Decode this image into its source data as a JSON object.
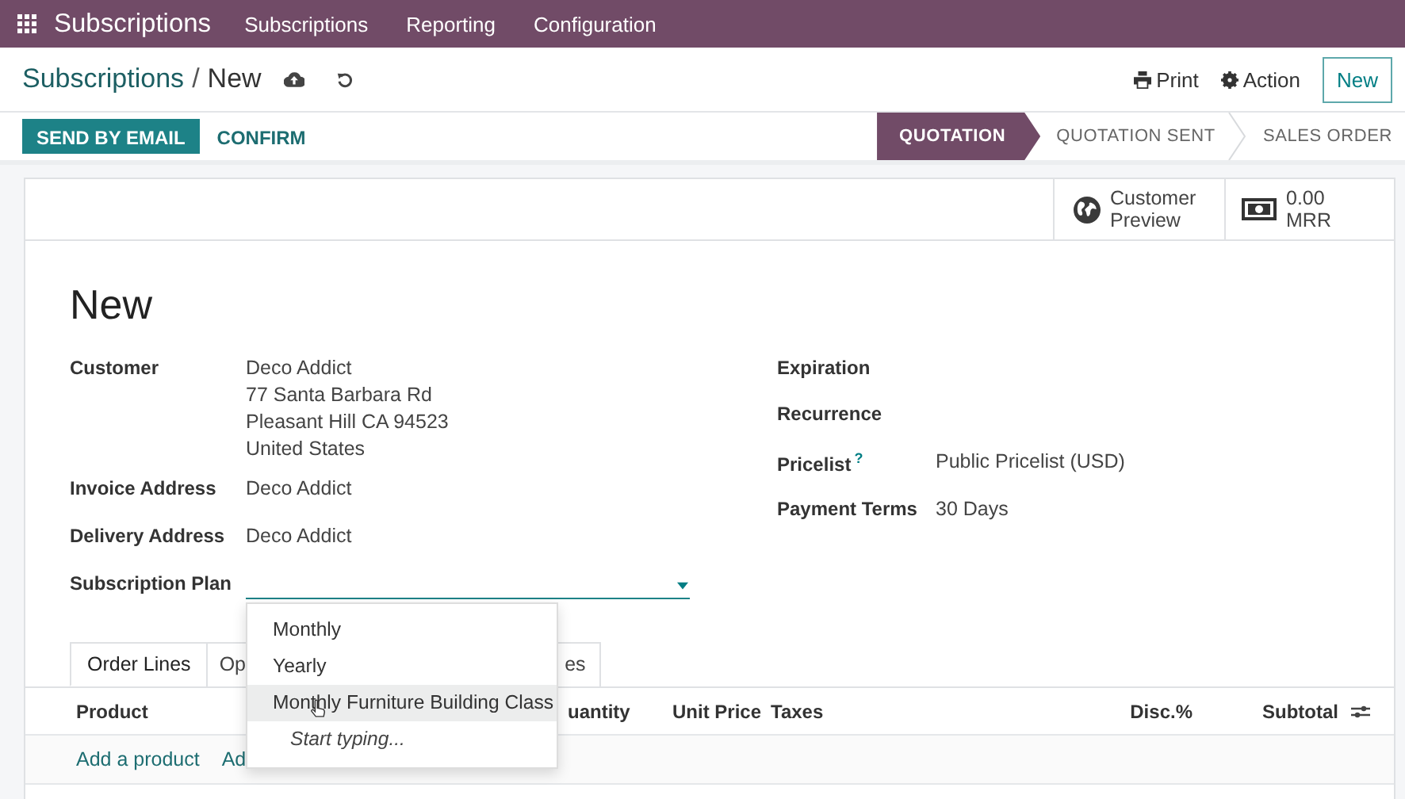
{
  "topbar": {
    "app": "Subscriptions",
    "menu": [
      "Subscriptions",
      "Reporting",
      "Configuration"
    ]
  },
  "breadcrumb": {
    "parent": "Subscriptions",
    "separator": "/",
    "current": "New"
  },
  "actions": [
    {
      "label": "Print",
      "kind": "print"
    },
    {
      "label": "Action",
      "kind": "gear"
    }
  ],
  "new_button": "New",
  "buttons": [
    {
      "label": "SEND BY EMAIL",
      "primary": true
    },
    {
      "label": "CONFIRM",
      "primary": false
    }
  ],
  "stages": [
    {
      "label": "QUOTATION",
      "selected": true
    },
    {
      "label": "QUOTATION SENT",
      "selected": false
    },
    {
      "label": "SALES ORDER",
      "selected": false
    }
  ],
  "smart_buttons": [
    {
      "kind": "globe",
      "lines": [
        "Customer",
        "Preview"
      ]
    },
    {
      "kind": "money",
      "lines": [
        "0.00",
        "MRR"
      ]
    }
  ],
  "title": "New",
  "left_fields": [
    {
      "label": "Customer",
      "lines": [
        "Deco Addict",
        "77 Santa Barbara Rd",
        "Pleasant Hill CA 94523",
        "United States"
      ]
    },
    {
      "label": "Invoice Address",
      "lines": [
        "Deco Addict"
      ]
    },
    {
      "label": "Delivery Address",
      "lines": [
        "Deco Addict"
      ]
    }
  ],
  "subscription_plan": {
    "label": "Subscription Plan"
  },
  "right_fields": [
    {
      "label": "Expiration"
    },
    {
      "label": "Recurrence"
    },
    {
      "label": "Pricelist",
      "help": "?",
      "value": "Public Pricelist (USD)"
    },
    {
      "label": "Payment Terms",
      "value": "30 Days"
    }
  ],
  "tabs": [
    {
      "label": "Order Lines",
      "selected": true
    },
    {
      "label": "Op",
      "selected": false
    },
    {
      "label": "es",
      "selected": false
    }
  ],
  "table": {
    "columns": [
      "Product",
      "uantity",
      "Unit Price",
      "Taxes",
      "Disc.%",
      "Subtotal"
    ],
    "add_links": [
      "Add a product",
      "Ad"
    ]
  },
  "dropdown": {
    "options": [
      {
        "label": "Monthly",
        "kind": "option",
        "hovered": false
      },
      {
        "label": "Yearly",
        "kind": "option",
        "hovered": false
      },
      {
        "label": "Monthly Furniture Building Class",
        "kind": "option",
        "hovered": true
      },
      {
        "label": "Start typing...",
        "kind": "hint",
        "hovered": false
      }
    ]
  }
}
